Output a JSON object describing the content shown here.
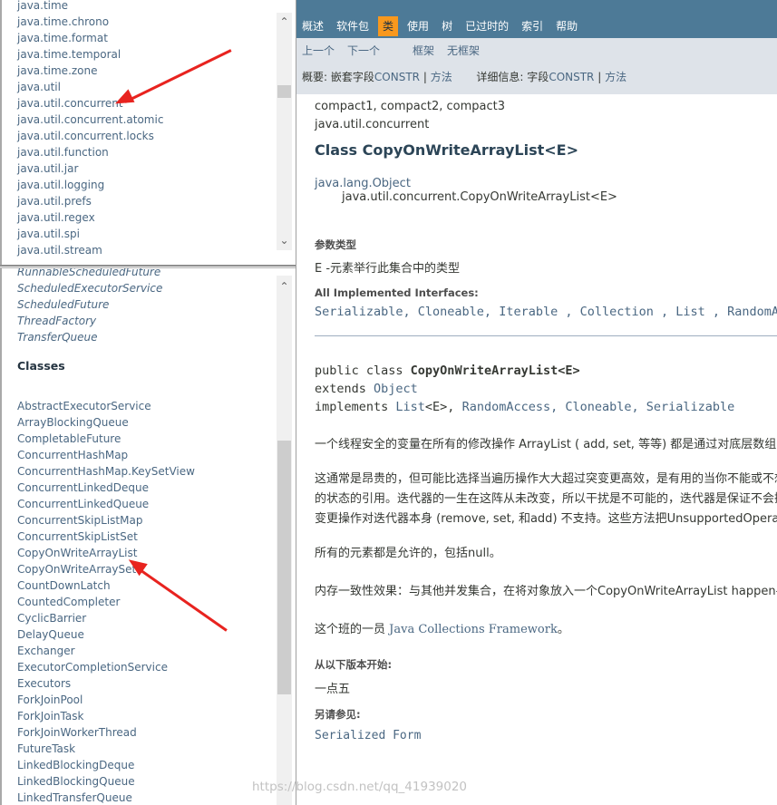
{
  "packages": [
    "java.time",
    "java.time.chrono",
    "java.time.format",
    "java.time.temporal",
    "java.time.zone",
    "java.util",
    "java.util.concurrent",
    "java.util.concurrent.atomic",
    "java.util.concurrent.locks",
    "java.util.function",
    "java.util.jar",
    "java.util.logging",
    "java.util.prefs",
    "java.util.regex",
    "java.util.spi",
    "java.util.stream"
  ],
  "interfaces_tail": [
    "RunnableScheduledFuture",
    "ScheduledExecutorService",
    "ScheduledFuture",
    "ThreadFactory",
    "TransferQueue"
  ],
  "classes_heading": "Classes",
  "classes": [
    "AbstractExecutorService",
    "ArrayBlockingQueue",
    "CompletableFuture",
    "ConcurrentHashMap",
    "ConcurrentHashMap.KeySetView",
    "ConcurrentLinkedDeque",
    "ConcurrentLinkedQueue",
    "ConcurrentSkipListMap",
    "ConcurrentSkipListSet",
    "CopyOnWriteArrayList",
    "CopyOnWriteArraySet",
    "CountDownLatch",
    "CountedCompleter",
    "CyclicBarrier",
    "DelayQueue",
    "Exchanger",
    "ExecutorCompletionService",
    "Executors",
    "ForkJoinPool",
    "ForkJoinTask",
    "ForkJoinWorkerThread",
    "FutureTask",
    "LinkedBlockingDeque",
    "LinkedBlockingQueue",
    "LinkedTransferQueue"
  ],
  "nav": {
    "top": [
      "概述",
      "软件包",
      "类",
      "使用",
      "树",
      "已过时的",
      "索引",
      "帮助"
    ],
    "prev": "上一个",
    "next": "下一个",
    "frames": "框架",
    "noframes": "无框架",
    "summary_label": "概要:",
    "summary_nested": "嵌套",
    "summary_field": "字段",
    "summary_constr": "CONSTR",
    "sep": "|",
    "method": "方法",
    "detail_label": "详细信息:",
    "detail_field": "字段",
    "detail_constr": "CONSTR"
  },
  "content": {
    "profiles": "compact1, compact2, compact3",
    "package": "java.util.concurrent",
    "title": "Class CopyOnWriteArrayList<E>",
    "super": "java.lang.Object",
    "self": "java.util.concurrent.CopyOnWriteArrayList<E>",
    "param_label": "参数类型",
    "param_desc": "E -元素举行此集合中的类型",
    "impl_label": "All Implemented Interfaces:",
    "impl_list": "Serializable, Cloneable, Iterable , Collection , List , RandomAccess",
    "decl1_pre": "public class ",
    "decl1_name": "CopyOnWriteArrayList<E>",
    "decl2_pre": "extends ",
    "decl2_link": "Object",
    "decl3_pre": "implements ",
    "decl3_list": "List",
    "decl3_mid": "<E>, ",
    "decl3_rest": "RandomAccess, Cloneable, Serializable",
    "p1": "一个线程安全的变量在所有的修改操作 ArrayList ( add, set, 等等) 都是通过对底层数组的一个新的副本来实现的。",
    "p2a": "这通常是昂贵的，但可能比选择当遍历操作大大超过突变更高效，是有用的当你不能或不想同步遍历，但需要防止并发线程之间的干扰。",
    "p2b": "的状态的引用。迭代器的一生在这阵从未改变，所以干扰是不可能的，迭代器是保证不会抛出ConcurrentModificationException。",
    "p2c": "变更操作对迭代器本身 (remove, set, 和add) 不支持。这些方法把UnsupportedOperationException。",
    "p3": "所有的元素都是允许的，包括null。",
    "p4": "内存一致性效果：与其他并发集合，在将对象放入一个CopyOnWriteArrayList happen-before的行动",
    "p5_pre": "这个班的一员 ",
    "p5_link": "Java Collections Framework",
    "p5_post": "。",
    "since_label": "从以下版本开始:",
    "since_val": "一点五",
    "see_label": "另请参见:",
    "see_val": "Serialized Form"
  },
  "watermark": "https://blog.csdn.net/qq_41939020",
  "colors": {
    "nav_bg": "#4D7A97",
    "active_tab": "#F8981D",
    "subnav_bg": "#DEE3E9",
    "link": "#4A6782",
    "arrow": "#E8231F"
  }
}
